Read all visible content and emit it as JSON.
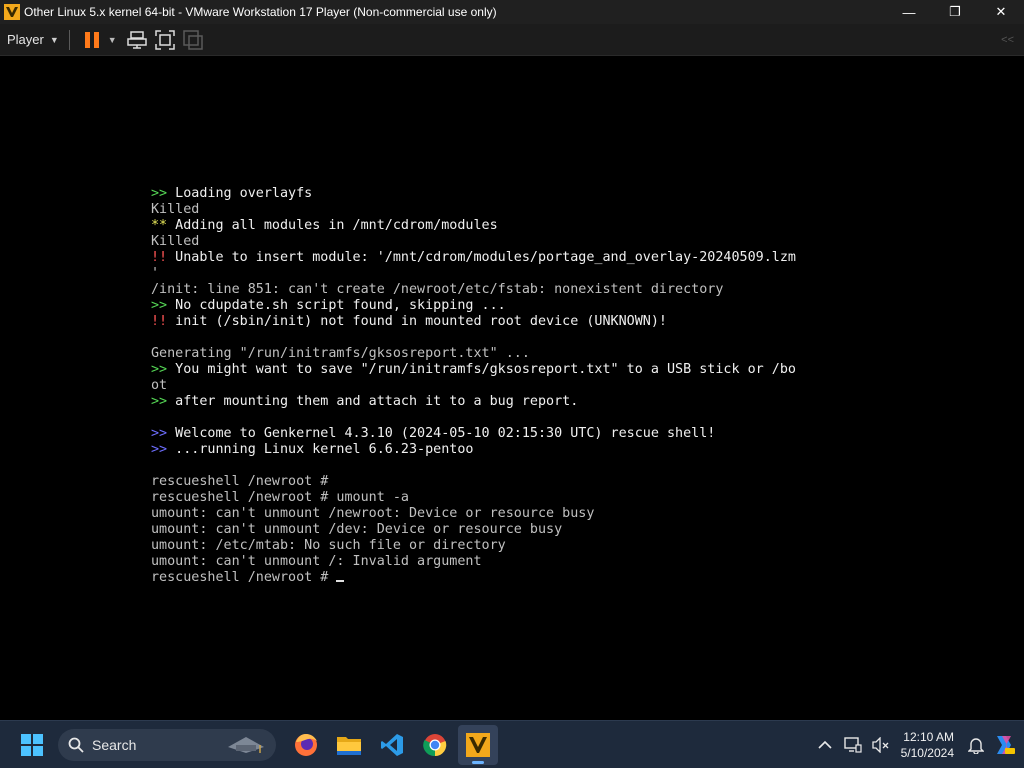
{
  "window": {
    "title": "Other Linux 5.x kernel 64-bit - VMware Workstation 17 Player (Non-commercial use only)",
    "controls": {
      "minimize": "—",
      "maximize": "❐",
      "close": "✕"
    }
  },
  "toolbar": {
    "player_label": "Player",
    "icons": [
      "pause-icon",
      "send-ctrl-alt-del-icon",
      "fullscreen-icon",
      "unity-icon"
    ],
    "collapse_label": "<<"
  },
  "console": {
    "lines": [
      {
        "prefix": ">>",
        "prefix_color": "green",
        "text": " Loading overlayfs"
      },
      {
        "prefix": "",
        "prefix_color": "",
        "text": "Killed"
      },
      {
        "prefix": "**",
        "prefix_color": "yellow",
        "text": " Adding all modules in /mnt/cdrom/modules"
      },
      {
        "prefix": "",
        "prefix_color": "",
        "text": "Killed"
      },
      {
        "prefix": "!!",
        "prefix_color": "red",
        "text": " Unable to insert module: '/mnt/cdrom/modules/portage_and_overlay-20240509.lzm"
      },
      {
        "prefix": "",
        "prefix_color": "",
        "text": "'"
      },
      {
        "prefix": "",
        "prefix_color": "",
        "text": "/init: line 851: can't create /newroot/etc/fstab: nonexistent directory"
      },
      {
        "prefix": ">>",
        "prefix_color": "green",
        "text": " No cdupdate.sh script found, skipping ..."
      },
      {
        "prefix": "!!",
        "prefix_color": "red",
        "text": " init (/sbin/init) not found in mounted root device (UNKNOWN)!"
      },
      {
        "prefix": "",
        "prefix_color": "",
        "text": ""
      },
      {
        "prefix": "",
        "prefix_color": "",
        "text": "Generating \"/run/initramfs/gksosreport.txt\" ..."
      },
      {
        "prefix": ">>",
        "prefix_color": "green",
        "text": " You might want to save \"/run/initramfs/gksosreport.txt\" to a USB stick or /bo"
      },
      {
        "prefix": "",
        "prefix_color": "",
        "text": "ot"
      },
      {
        "prefix": ">>",
        "prefix_color": "green",
        "text": " after mounting them and attach it to a bug report."
      },
      {
        "prefix": "",
        "prefix_color": "",
        "text": ""
      },
      {
        "prefix": ">>",
        "prefix_color": "blue",
        "text": " Welcome to Genkernel 4.3.10 (2024-05-10 02:15:30 UTC) rescue shell!"
      },
      {
        "prefix": ">>",
        "prefix_color": "blue",
        "text": " ...running Linux kernel 6.6.23-pentoo"
      },
      {
        "prefix": "",
        "prefix_color": "",
        "text": ""
      },
      {
        "prefix": "",
        "prefix_color": "",
        "text": "rescueshell /newroot #"
      },
      {
        "prefix": "",
        "prefix_color": "",
        "text": "rescueshell /newroot # umount -a"
      },
      {
        "prefix": "",
        "prefix_color": "",
        "text": "umount: can't unmount /newroot: Device or resource busy"
      },
      {
        "prefix": "",
        "prefix_color": "",
        "text": "umount: can't unmount /dev: Device or resource busy"
      },
      {
        "prefix": "",
        "prefix_color": "",
        "text": "umount: /etc/mtab: No such file or directory"
      },
      {
        "prefix": "",
        "prefix_color": "",
        "text": "umount: can't unmount /: Invalid argument"
      }
    ],
    "prompt": "rescueshell /newroot # "
  },
  "taskbar": {
    "search_label": "Search",
    "apps": [
      {
        "name": "firefox-icon"
      },
      {
        "name": "file-explorer-icon"
      },
      {
        "name": "vscode-icon"
      },
      {
        "name": "chrome-icon"
      },
      {
        "name": "vmware-icon",
        "active": true
      }
    ],
    "clock_time": "12:10 AM",
    "clock_date": "5/10/2024"
  },
  "colors": {
    "green": "#55d655",
    "yellow": "#e8e85a",
    "red": "#ff5555",
    "blue": "#6e6eff",
    "taskbar": "#1e2a3c"
  }
}
